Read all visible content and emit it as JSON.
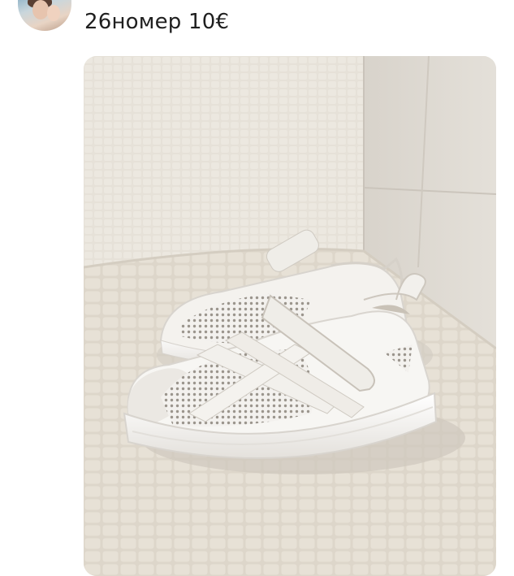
{
  "message": {
    "caption": "26номер 10€",
    "avatar_icon": "avatar-icon",
    "photo": {
      "subject": "shoes-photo"
    }
  }
}
